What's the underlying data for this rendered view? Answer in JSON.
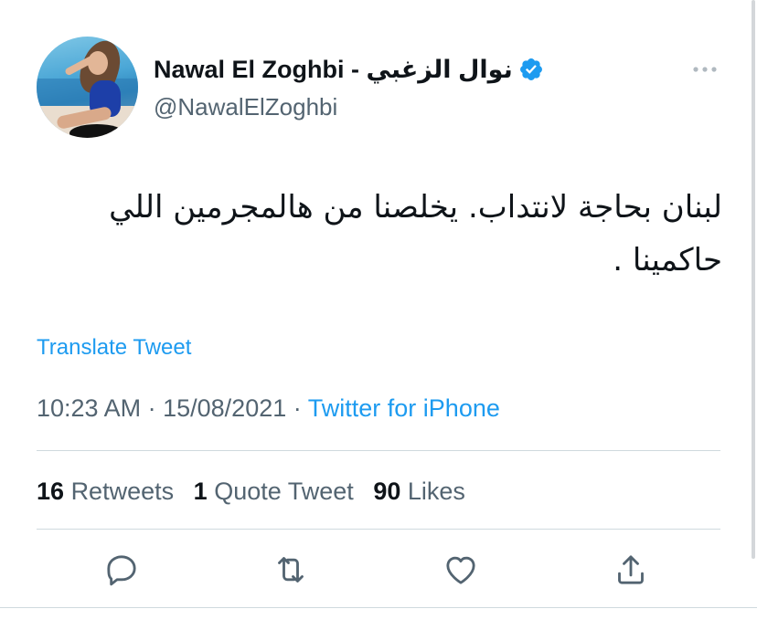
{
  "author": {
    "display_name": "Nawal El Zoghbi - نوال الزغبي",
    "handle": "@NawalElZoghbi",
    "verified": true,
    "avatar_alt": "profile photo"
  },
  "tweet": {
    "text": "لبنان بحاجة لانتداب. يخلصنا من هالمجرمين اللي حاكمينا .",
    "translate_label": "Translate Tweet",
    "time": "10:23 AM",
    "date": "15/08/2021",
    "separator": "·",
    "source": "Twitter for iPhone"
  },
  "stats": {
    "retweets_count": "16",
    "retweets_label": "Retweets",
    "quotes_count": "1",
    "quotes_label": "Quote Tweet",
    "likes_count": "90",
    "likes_label": "Likes"
  },
  "actions": {
    "reply_icon": "reply-icon",
    "retweet_icon": "retweet-icon",
    "like_icon": "heart-icon",
    "share_icon": "share-icon"
  },
  "colors": {
    "accent": "#1d9bf0",
    "secondary_text": "#536471",
    "primary_text": "#0f1419",
    "divider": "#cfd9de"
  }
}
